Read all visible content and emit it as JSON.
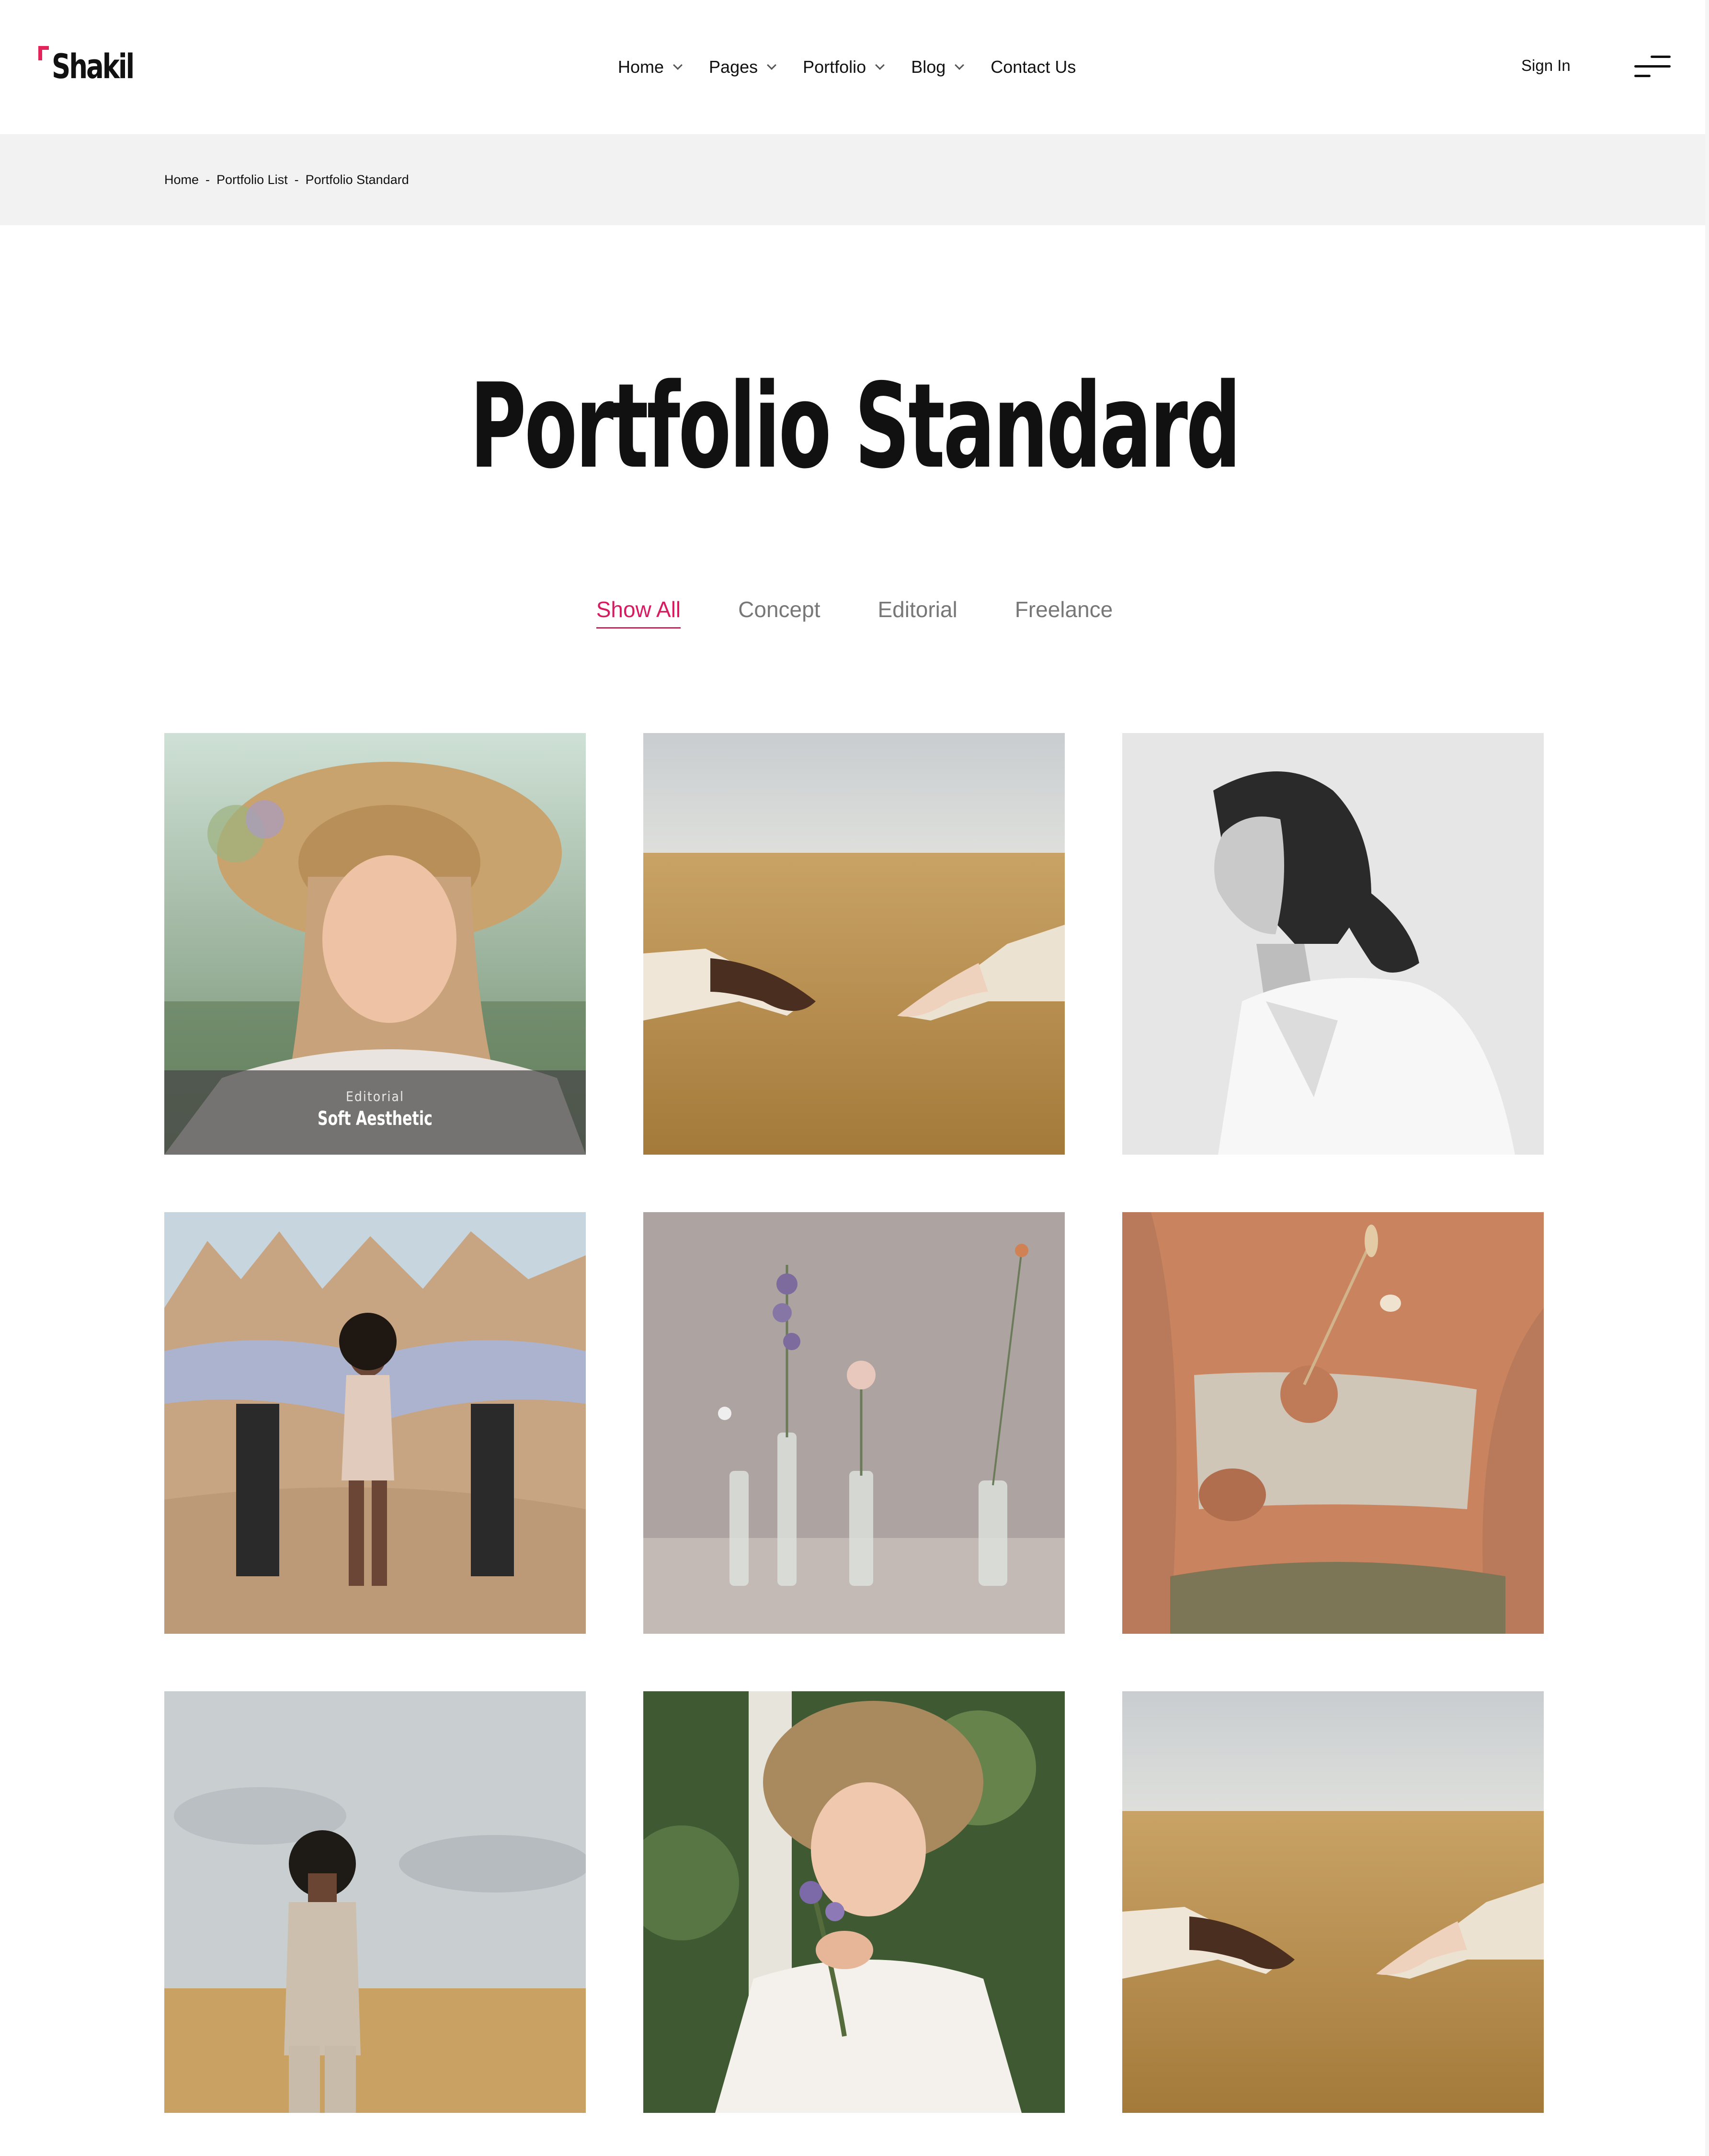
{
  "brand": {
    "name": "Shakil",
    "accent": "#e3245a"
  },
  "nav": {
    "items": [
      {
        "label": "Home",
        "has_dropdown": true
      },
      {
        "label": "Pages",
        "has_dropdown": true
      },
      {
        "label": "Portfolio",
        "has_dropdown": true
      },
      {
        "label": "Blog",
        "has_dropdown": true
      },
      {
        "label": "Contact Us",
        "has_dropdown": false
      }
    ],
    "sign_in": "Sign In",
    "menu_icon": "hamburger-menu-icon"
  },
  "breadcrumb": {
    "items": [
      "Home",
      "Portfolio List",
      "Portfolio Standard"
    ],
    "separator": "-"
  },
  "page": {
    "title": "Portfolio Standard"
  },
  "filters": {
    "items": [
      "Show All",
      "Concept",
      "Editorial",
      "Freelance"
    ],
    "active": "Show All",
    "active_color": "#d81b60"
  },
  "portfolio": {
    "items": [
      {
        "image": "woman in straw hat with flowers",
        "hover_category": "Editorial",
        "hover_title": "Soft Aesthetic"
      },
      {
        "image": "two hands reaching over wheat field"
      },
      {
        "image": "black and white portrait of woman"
      },
      {
        "image": "woman with blue fabric in desert"
      },
      {
        "image": "dried flowers in glass vases"
      },
      {
        "image": "woman holding dried flowers"
      },
      {
        "image": "man in suit with covered eyes in field"
      },
      {
        "image": "woman in straw hat smelling flowers"
      },
      {
        "image": "two hands reaching over wheat field"
      }
    ]
  }
}
